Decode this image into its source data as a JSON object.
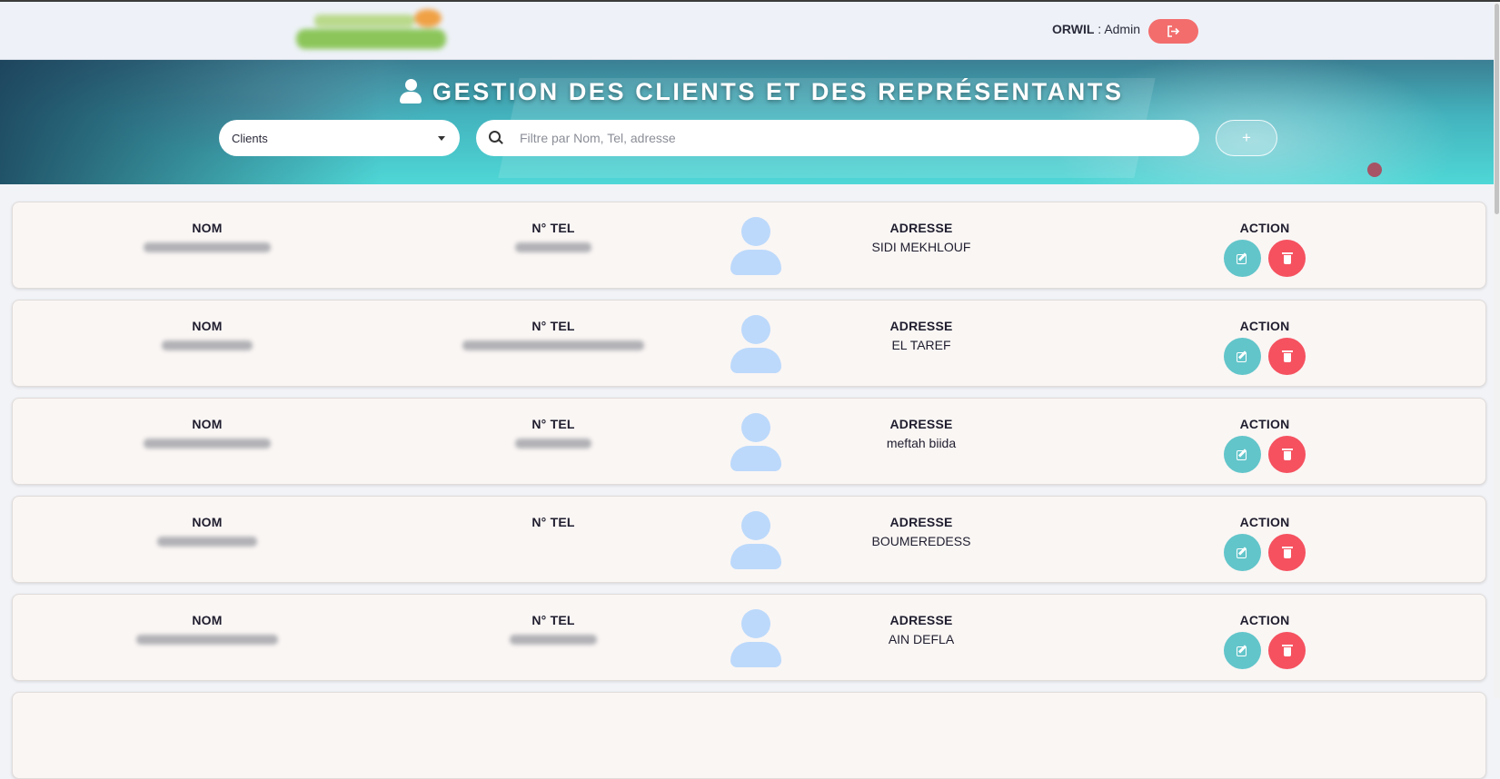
{
  "header": {
    "org": "ORWIL",
    "separator": ":",
    "role": "Admin",
    "logout_icon": "logout-icon"
  },
  "hero": {
    "title": "GESTION DES CLIENTS ET DES REPRÉSENTANTS",
    "type_select": {
      "value": "Clients"
    },
    "search": {
      "placeholder": "Filtre par Nom, Tel, adresse"
    },
    "add_label": "+"
  },
  "labels": {
    "nom": "NOM",
    "tel": "N° TEL",
    "adresse": "ADRESSE",
    "action": "ACTION"
  },
  "clients": [
    {
      "adresse": "SIDI MEKHLOUF",
      "has_tel": true
    },
    {
      "adresse": "EL TAREF",
      "has_tel": true
    },
    {
      "adresse": "meftah biida",
      "has_tel": true
    },
    {
      "adresse": "BOUMEREDESS",
      "has_tel": false
    },
    {
      "adresse": "AIN DEFLA",
      "has_tel": true
    }
  ]
}
